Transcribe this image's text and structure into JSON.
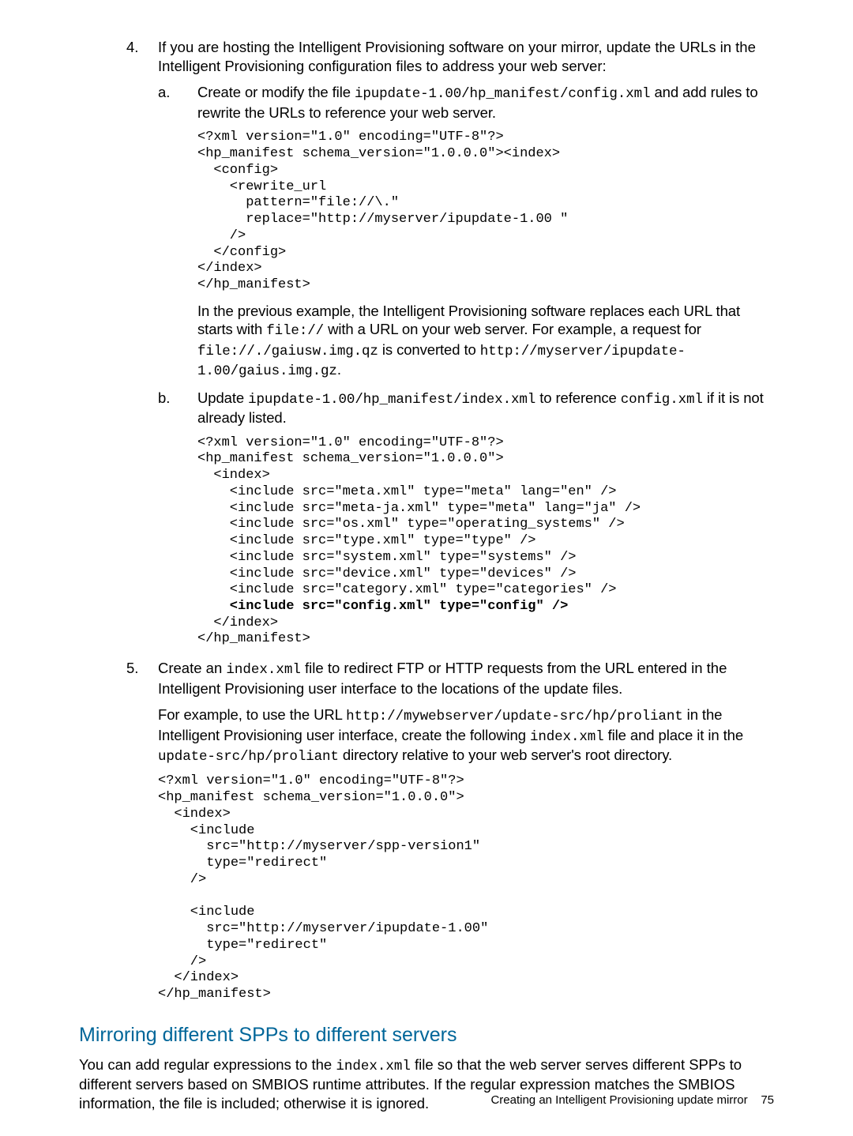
{
  "step4": {
    "num": "4.",
    "intro": "If you are hosting the Intelligent Provisioning software on your mirror, update the URLs in the Intelligent Provisioning configuration files to address your web server:",
    "a": {
      "num": "a.",
      "line_pre": "Create or modify the file ",
      "file": "ipupdate-1.00/hp_manifest/config.xml",
      "line_post": " and add rules to rewrite the URLs to reference your web server.",
      "code": "<?xml version=\"1.0\" encoding=\"UTF-8\"?>\n<hp_manifest schema_version=\"1.0.0.0\"><index>\n  <config>\n    <rewrite_url\n      pattern=\"file://\\.\"\n      replace=\"http://myserver/ipupdate-1.00 \"\n    />\n  </config>\n</index>\n</hp_manifest>",
      "after1_pre": "In the previous example, the Intelligent Provisioning software replaces each URL that starts with ",
      "after1_c1": "file://",
      "after1_mid": " with a URL on your web server. For example, a request for ",
      "after1_c2": "file://./gaiusw.img.qz",
      "after1_conv": " is converted to ",
      "after1_c3": "http://myserver/ipupdate-1.00/gaius.img.gz",
      "after1_end": "."
    },
    "b": {
      "num": "b.",
      "line_pre": "Update ",
      "file": "ipupdate-1.00/hp_manifest/index.xml",
      "line_mid": " to reference ",
      "file2": "config.xml",
      "line_post": " if it is not already listed.",
      "code": "<?xml version=\"1.0\" encoding=\"UTF-8\"?>\n<hp_manifest schema_version=\"1.0.0.0\">\n  <index>\n    <include src=\"meta.xml\" type=\"meta\" lang=\"en\" />\n    <include src=\"meta-ja.xml\" type=\"meta\" lang=\"ja\" />\n    <include src=\"os.xml\" type=\"operating_systems\" />\n    <include src=\"type.xml\" type=\"type\" />\n    <include src=\"system.xml\" type=\"systems\" />\n    <include src=\"device.xml\" type=\"devices\" />\n    <include src=\"category.xml\" type=\"categories\" />",
      "code_bold": "    <include src=\"config.xml\" type=\"config\" />",
      "code_tail": "  </index>\n</hp_manifest>"
    }
  },
  "step5": {
    "num": "5.",
    "p1_pre": "Create an ",
    "p1_file": "index.xml",
    "p1_post": " file to redirect FTP or HTTP requests from the URL entered in the Intelligent Provisioning user interface to the locations of the update files.",
    "p2_pre": "For example, to use the URL ",
    "p2_url": "http://mywebserver/update-src/hp/proliant",
    "p2_mid": " in the Intelligent Provisioning user interface, create the following ",
    "p2_file": "index.xml",
    "p2_mid2": " file and place it in the ",
    "p2_dir": "update-src/hp/proliant",
    "p2_post": " directory relative to your web server's root directory.",
    "code": "<?xml version=\"1.0\" encoding=\"UTF-8\"?>\n<hp_manifest schema_version=\"1.0.0.0\">\n  <index>\n    <include\n      src=\"http://myserver/spp-version1\"\n      type=\"redirect\"\n    />\n\n    <include\n      src=\"http://myserver/ipupdate-1.00\"\n      type=\"redirect\"\n    />\n  </index>\n</hp_manifest>"
  },
  "mirror": {
    "heading": "Mirroring different SPPs to different servers",
    "p1_pre": "You can add regular expressions to the ",
    "p1_file": "index.xml",
    "p1_post": " file so that the web server serves different SPPs to different servers based on SMBIOS runtime attributes. If the regular expression matches the SMBIOS information, the file is included; otherwise it is ignored."
  },
  "footer": {
    "text": "Creating an Intelligent Provisioning update mirror",
    "page": "75"
  }
}
